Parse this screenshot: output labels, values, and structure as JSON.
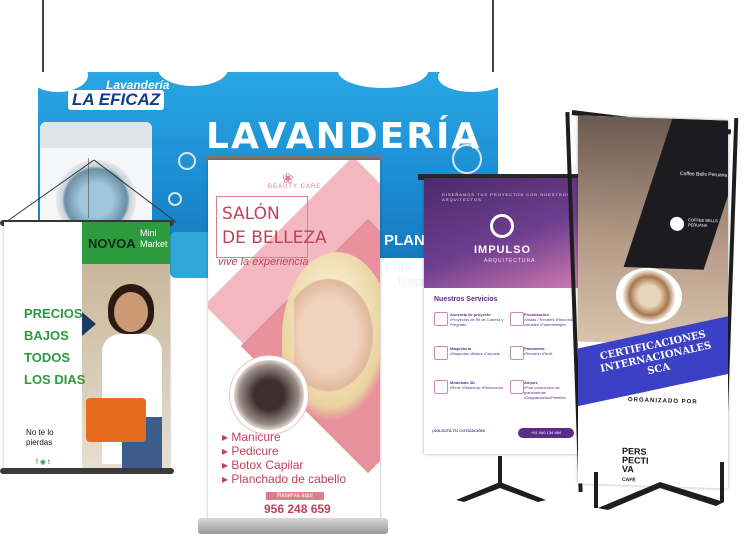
{
  "laundry": {
    "brand_line1": "Lavandería",
    "brand_line2": "LA EFICAZ",
    "title": "LAVANDERÍA",
    "sub1": "PLANCHAD",
    "sub2": "y las",
    "sub3": "limpi"
  },
  "novoa": {
    "name": "NOVOA",
    "mini": "Mini",
    "market": "Market",
    "price_lines": [
      "PRECIOS",
      "BAJOS",
      "TODOS",
      "LOS DIAS"
    ],
    "note_line1": "No te lo",
    "note_line2": "pierdas",
    "social": "f ◉ t"
  },
  "salon": {
    "logo_text": "BEAUTY CARE",
    "title_line1": "SALÓN",
    "title_line2": "DE BELLEZA",
    "tagline": "vive la experiencia",
    "services": [
      "Manicure",
      "Pedicure",
      "Botox Capilar",
      "Planchado de cabello"
    ],
    "reserve": "Reserva aquí",
    "phone": "956 248 659"
  },
  "impulso": {
    "small_header": "DISEÑAMOS TUS PROYECTOS CON NUESTROS ARQUITECTOS",
    "title": "IMPULSO",
    "subtitle": "ARQUITECTURA",
    "services_title": "Nuestros Servicios",
    "services": [
      {
        "title": "Asesoría de proyecto",
        "desc": "•Proyectos de fin de Carrera y Pregrado"
      },
      {
        "title": "Fiscalización",
        "desc": "•Vistas / Renders •Recorridos virtuales •Fotomontajes"
      },
      {
        "title": "Maquetería",
        "desc": "•Maquetas •Bases •Ceposte"
      },
      {
        "title": "Panimetría",
        "desc": "•Revisión •Revit"
      },
      {
        "title": "Modelado 3D",
        "desc": "•Revit •SketchUp •Rhinoceros"
      },
      {
        "title": "Ampos",
        "desc": "•Post producción de planimetrías •Diagramación/Paneles"
      }
    ],
    "whatsapp": "+51 940 134 984",
    "footer": "¡SOLICITA TU COTIZACIÓN!"
  },
  "coffee": {
    "logo_title": "Coffee Bells Peruana",
    "brand": "COFFEE BELLS PERUANA",
    "certification": "CERTIFICACIONES INTERNACIONALES SCA",
    "organized_by": "ORGANIZADO POR",
    "perspectiva_line1": "PERS",
    "perspectiva_line2": "PECTI",
    "perspectiva_line3": "VA",
    "perspectiva_line4": "CAFÉ"
  },
  "colors": {
    "laundry_blue": "#1c8fd3",
    "novoa_green": "#2d9a3e",
    "salon_pink": "#c2405a",
    "impulso_purple": "#5b2d86",
    "coffee_blue": "#3b40c4"
  }
}
